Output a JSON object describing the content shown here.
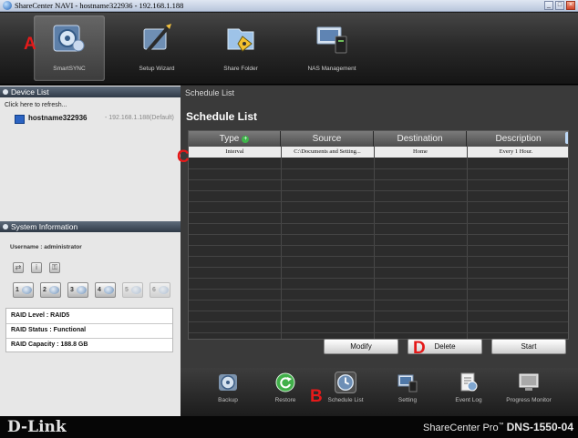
{
  "window": {
    "title": "ShareCenter NAVI - hostname322936 - 192.168.1.188",
    "controls": [
      "_",
      "□",
      "×"
    ]
  },
  "toolbar": {
    "items": [
      {
        "label": "SmartSYNC",
        "icon": "smartsync-icon",
        "active": true
      },
      {
        "label": "Setup Wizard",
        "icon": "setup-wizard-icon",
        "active": false
      },
      {
        "label": "Share Folder",
        "icon": "share-folder-icon",
        "active": false
      },
      {
        "label": "NAS Management",
        "icon": "nas-management-icon",
        "active": false
      }
    ]
  },
  "callouts": {
    "a": "A",
    "b": "B",
    "c": "C",
    "d": "D"
  },
  "device_list": {
    "header": "Device List",
    "refresh_text": "Click here to refresh...",
    "device_name": "hostname322936",
    "device_ip": "- 192.168.1.188(Default)"
  },
  "system_info": {
    "header": "System Information",
    "username_text": "Username : administrator",
    "quick_icons": [
      "share-icon",
      "info-icon",
      "lock-icon"
    ],
    "disks": [
      {
        "num": "1",
        "present": true
      },
      {
        "num": "2",
        "present": true
      },
      {
        "num": "3",
        "present": true
      },
      {
        "num": "4",
        "present": true
      },
      {
        "num": "5",
        "present": false
      },
      {
        "num": "6",
        "present": false
      }
    ],
    "raid_level": "RAID Level : RAID5",
    "raid_status": "RAID Status : Functional",
    "raid_capacity": "RAID Capacity : 188.8 GB"
  },
  "main": {
    "breadcrumb": "Schedule List",
    "heading": "Schedule List",
    "columns": [
      "Type",
      "Source",
      "Destination",
      "Description"
    ],
    "rows": [
      {
        "type": "Interval",
        "source": "C:\\Documents and Setting...",
        "destination": "Home",
        "description": "Every 1 Hour."
      }
    ],
    "buttons": {
      "modify": "Modify",
      "delete": "Delete",
      "start": "Start"
    }
  },
  "bottom_bar": {
    "items": [
      {
        "label": "Backup",
        "icon": "backup-icon",
        "active": false
      },
      {
        "label": "Restore",
        "icon": "restore-icon",
        "active": false
      },
      {
        "label": "Schedule List",
        "icon": "schedule-list-icon",
        "active": true
      },
      {
        "label": "Setting",
        "icon": "setting-icon",
        "active": false
      },
      {
        "label": "Event Log",
        "icon": "event-log-icon",
        "active": false
      },
      {
        "label": "Progress Monitor",
        "icon": "progress-monitor-icon",
        "active": false
      }
    ]
  },
  "footer": {
    "brand": "D-Link",
    "product": "ShareCenter Pro",
    "tm": "™",
    "model": "DNS-1550-04"
  },
  "colors": {
    "callout": "#e41a1a",
    "accent": "#2b63c2",
    "add_green": "#3eb54a"
  }
}
